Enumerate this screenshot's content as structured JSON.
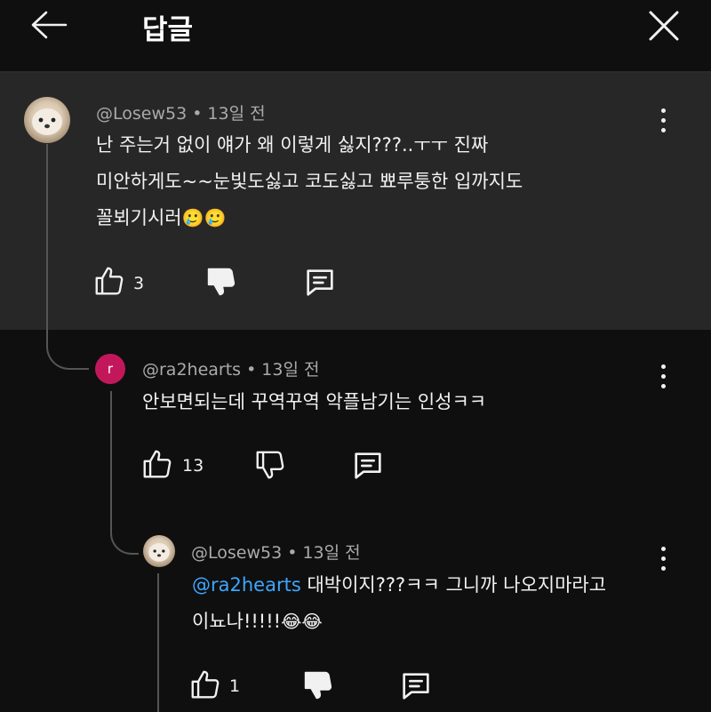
{
  "header": {
    "title": "답글",
    "back_icon": "arrow-left-icon",
    "close_icon": "close-icon"
  },
  "comments": [
    {
      "username": "@Losew53",
      "time": "13일 전",
      "lines": [
        "난 주는거 없이 얘가 왜 이렇게 싫지???..ㅜㅜ 진짜",
        "미안하게도~~눈빛도싫고 코도싫고 뾰루퉁한 입까지도",
        "꼴뵈기시러"
      ],
      "emojis": "🥲🥲",
      "likes": "3"
    },
    {
      "username": "@ra2hearts",
      "avatar_letter": "r",
      "time": "13일 전",
      "lines": [
        "안보면되는데 꾸역꾸역 악플남기는 인성ㅋㅋ"
      ],
      "likes": "13"
    },
    {
      "username": "@Losew53",
      "time": "13일 전",
      "mention": "@ra2hearts",
      "lines": [
        " 대박이지???ㅋㅋ 그니까 나오지마라고",
        "이뇨나!!!!!"
      ],
      "emojis": "😂😂",
      "likes": "1"
    }
  ],
  "colors": {
    "background": "#0f0f0f",
    "highlight": "#272727",
    "mention": "#3ea6ff",
    "avatar_r": "#c2185b"
  }
}
